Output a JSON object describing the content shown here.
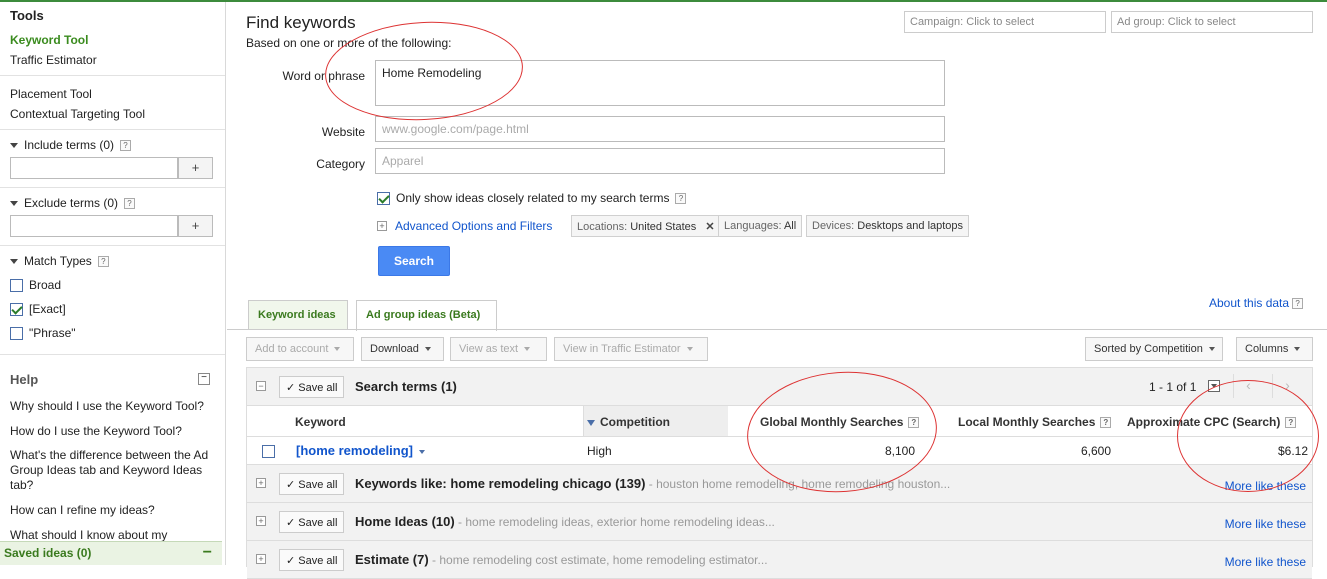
{
  "sidebar": {
    "tools_title": "Tools",
    "tools": [
      "Keyword Tool",
      "Traffic Estimator"
    ],
    "tools2": [
      "Placement Tool",
      "Contextual Targeting Tool"
    ],
    "include_terms": "Include terms (0)",
    "exclude_terms": "Exclude terms (0)",
    "plus": "+",
    "match_types": "Match Types",
    "matches": [
      {
        "label": "Broad",
        "checked": false
      },
      {
        "label": "[Exact]",
        "checked": true
      },
      {
        "label": "\"Phrase\"",
        "checked": false
      }
    ],
    "help_title": "Help",
    "help_collapse": "−",
    "help_items": [
      "Why should I use the Keyword Tool?",
      "How do I use the Keyword Tool?",
      "What's the difference between the Ad Group Ideas tab and Keyword Ideas tab?",
      "How can I refine my ideas?",
      "What should I know about my"
    ],
    "saved_ideas": "Saved ideas (0)",
    "saved_minus": "−"
  },
  "header": {
    "title": "Find keywords",
    "subtitle": "Based on one or more of the following:",
    "campaign_placeholder": "Campaign: Click to select",
    "adgroup_placeholder": "Ad group: Click to select"
  },
  "form": {
    "word_label": "Word or phrase",
    "word_value": "Home Remodeling",
    "website_label": "Website",
    "website_placeholder": "www.google.com/page.html",
    "category_label": "Category",
    "category_placeholder": "Apparel",
    "closely_related": "Only show ideas closely related to my search terms",
    "advanced": "Advanced Options and Filters",
    "chips": {
      "locations_label": "Locations:",
      "locations_value": "United States",
      "languages_label": "Languages:",
      "languages_value": "All",
      "devices_label": "Devices:",
      "devices_value": "Desktops and laptops"
    },
    "search_button": "Search"
  },
  "tabs": [
    "Keyword ideas",
    "Ad group ideas (Beta)"
  ],
  "about_data": "About this data",
  "toolbar": {
    "add_to_account": "Add to account",
    "download": "Download",
    "view_as_text": "View as text",
    "view_traffic": "View in Traffic Estimator",
    "sorted_by": "Sorted by Competition",
    "columns": "Columns"
  },
  "search_terms": {
    "save_all": "Save all",
    "title": "Search terms (1)",
    "pager": "1 - 1 of 1",
    "headers": {
      "keyword": "Keyword",
      "competition": "Competition",
      "global": "Global Monthly Searches",
      "local": "Local Monthly Searches",
      "cpc": "Approximate CPC (Search)"
    },
    "row": {
      "keyword": "[home remodeling]",
      "competition": "High",
      "global": "8,100",
      "local": "6,600",
      "cpc": "$6.12"
    }
  },
  "groups": [
    {
      "title": "Keywords like: home remodeling chicago (139)",
      "desc": " - houston home remodeling, home remodeling houston...",
      "more": "More like these"
    },
    {
      "title": "Home Ideas (10)",
      "desc": " - home remodeling ideas, exterior home remodeling ideas...",
      "more": "More like these"
    },
    {
      "title": "Estimate (7)",
      "desc": " - home remodeling cost estimate, home remodeling estimator...",
      "more": "More like these"
    }
  ],
  "colors": {
    "accent_green": "#3a8b1e",
    "link_blue": "#1155cc",
    "button_blue": "#4a8af4",
    "annotation_red": "#d33"
  }
}
